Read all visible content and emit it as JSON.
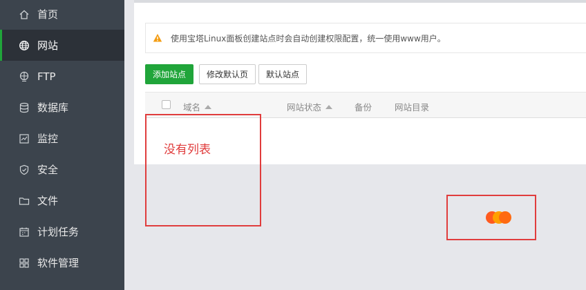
{
  "sidebar": {
    "items": [
      {
        "label": "首页",
        "icon": "home-icon"
      },
      {
        "label": "网站",
        "icon": "globe-icon",
        "active": true
      },
      {
        "label": "FTP",
        "icon": "ftp-icon"
      },
      {
        "label": "数据库",
        "icon": "database-icon"
      },
      {
        "label": "监控",
        "icon": "monitor-icon"
      },
      {
        "label": "安全",
        "icon": "shield-icon"
      },
      {
        "label": "文件",
        "icon": "folder-icon"
      },
      {
        "label": "计划任务",
        "icon": "calendar-icon"
      },
      {
        "label": "软件管理",
        "icon": "grid-icon"
      }
    ]
  },
  "alert": {
    "text": "使用宝塔Linux面板创建站点时会自动创建权限配置，统一使用www用户。"
  },
  "toolbar": {
    "add_site": "添加站点",
    "modify_default_page": "修改默认页",
    "default_site": "默认站点"
  },
  "table": {
    "columns": {
      "domain": "域名",
      "status": "网站状态",
      "remark": "备份",
      "directory": "网站目录"
    },
    "empty_text": "没有列表"
  },
  "colors": {
    "accent": "#20a53a",
    "sidebar_bg": "#3c444d",
    "annotation_red": "#e03c3c",
    "warning_orange": "#f39c12"
  }
}
